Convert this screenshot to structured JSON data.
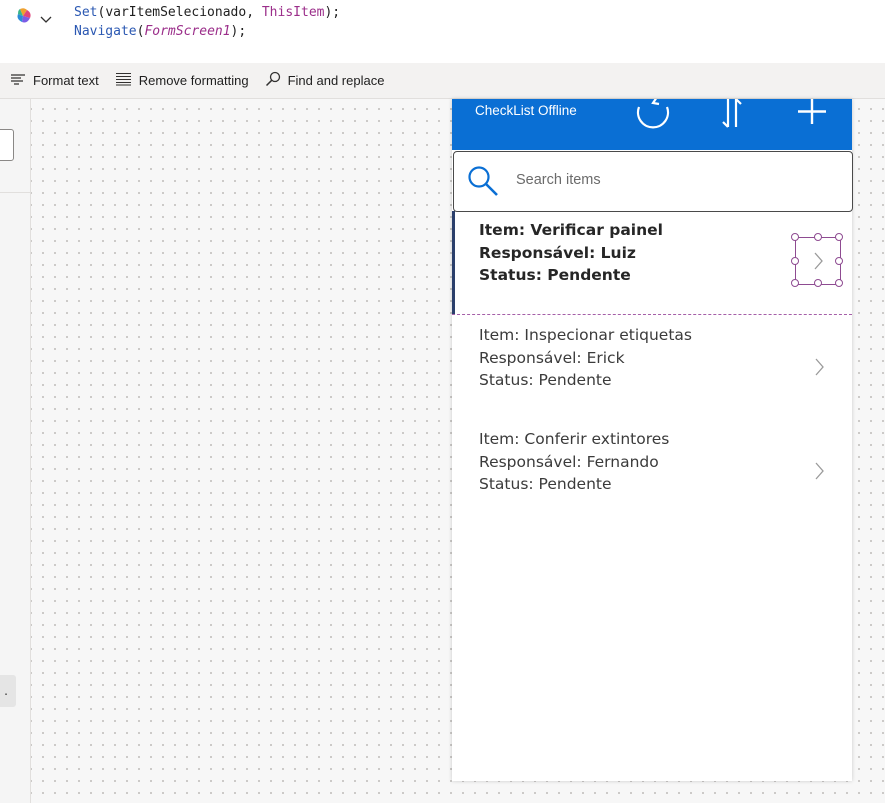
{
  "formula": {
    "line1": {
      "fn": "Set",
      "open": "(",
      "var": "varItemSelecionado",
      "sep": ", ",
      "this": "ThisItem",
      "close": ");"
    },
    "line2": {
      "fn": "Navigate",
      "open": "(",
      "arg": "FormScreen1",
      "close": ");"
    }
  },
  "toolbar": {
    "format_text": "Format text",
    "remove_formatting": "Remove formatting",
    "find_replace": "Find and replace"
  },
  "left_pane": {
    "more": "."
  },
  "app": {
    "title": "CheckList Offline",
    "header_color": "#0a6fd4",
    "search_placeholder": "Search items",
    "items": [
      {
        "item": "Item: Verificar painel",
        "resp": "Responsável: Luiz",
        "status": "Status: Pendente"
      },
      {
        "item": "Item: Inspecionar etiquetas",
        "resp": "Responsável: Erick",
        "status": "Status: Pendente"
      },
      {
        "item": "Item: Conferir extintores",
        "resp": "Responsável: Fernando",
        "status": "Status: Pendente"
      }
    ]
  }
}
